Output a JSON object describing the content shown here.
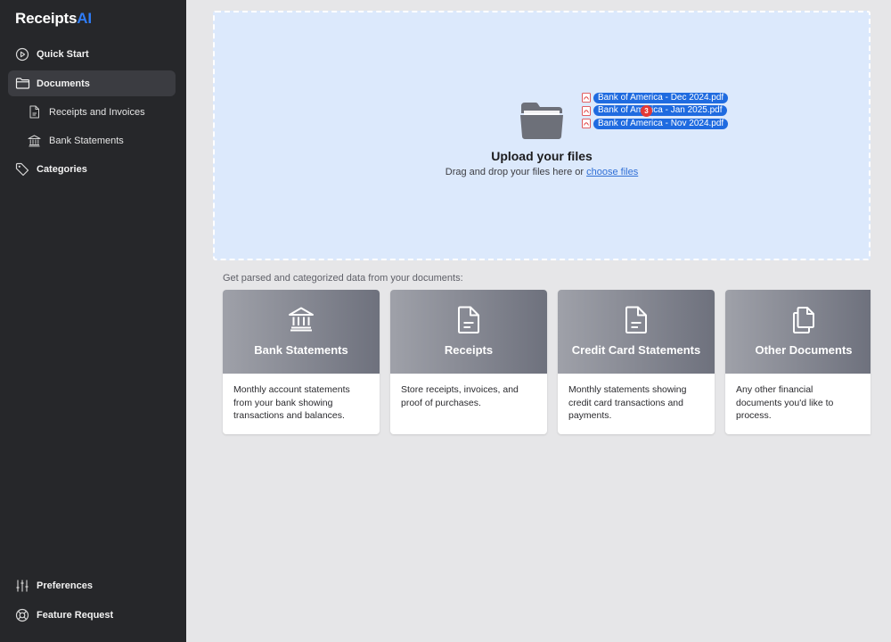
{
  "app": {
    "logo_main": "Receipts",
    "logo_accent": "AI",
    "accent_color": "#2f7cf6"
  },
  "sidebar": {
    "items": [
      {
        "label": "Quick Start",
        "icon": "play-circle-icon"
      },
      {
        "label": "Documents",
        "icon": "folder-icon",
        "active": true
      },
      {
        "label": "Receipts and Invoices",
        "icon": "document-icon"
      },
      {
        "label": "Bank Statements",
        "icon": "bank-icon"
      },
      {
        "label": "Categories",
        "icon": "tag-icon"
      }
    ],
    "bottom_items": [
      {
        "label": "Preferences",
        "icon": "sliders-icon"
      },
      {
        "label": "Feature Request",
        "icon": "lifebuoy-icon"
      }
    ]
  },
  "upload": {
    "title": "Upload your files",
    "subtitle_prefix": "Drag and drop your files here or ",
    "link_text": "choose files",
    "dragged_files": [
      "Bank of America - Dec 2024.pdf",
      "Bank of America - Jan 2025.pdf",
      "Bank of America - Nov 2024.pdf"
    ],
    "drag_count": "3"
  },
  "cards_section": {
    "label": "Get parsed and categorized data from your documents:",
    "cards": [
      {
        "title": "Bank Statements",
        "icon": "bank-icon",
        "description": "Monthly account statements from your bank showing transactions and balances."
      },
      {
        "title": "Receipts",
        "icon": "document-icon",
        "description": "Store receipts, invoices, and proof of purchases."
      },
      {
        "title": "Credit Card Statements",
        "icon": "document-icon",
        "description": "Monthly statements showing credit card transactions and payments."
      },
      {
        "title": "Other Documents",
        "icon": "documents-copy-icon",
        "description": "Any other financial documents you'd like to process."
      }
    ]
  }
}
